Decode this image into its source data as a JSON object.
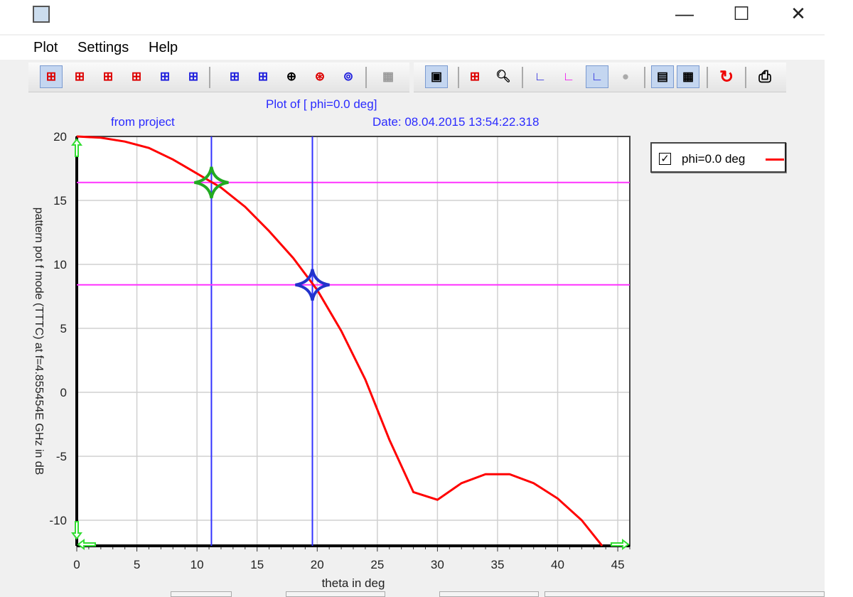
{
  "menu": [
    "Plot",
    "Settings",
    "Help"
  ],
  "window": {
    "minimize": "—",
    "maximize": "☐",
    "close": "✕"
  },
  "header": {
    "title": "Plot of [ phi=0.0 deg]",
    "source": "from project",
    "date": "Date: 08.04.2015 13:54:22.318"
  },
  "legend": {
    "label": "phi=0.0 deg",
    "checked": "✓"
  },
  "chart_data": {
    "type": "line",
    "title": "Plot of [ phi=0.0 deg]",
    "xlabel": "theta in deg",
    "ylabel": "pattern pot f mode (TTTC) at f=4.855454E GHz in dB",
    "xlim": [
      0,
      46
    ],
    "ylim": [
      -12,
      20
    ],
    "xticks": [
      0,
      5,
      10,
      15,
      20,
      25,
      30,
      35,
      40,
      45
    ],
    "yticks": [
      20,
      15,
      10,
      5,
      0,
      -5,
      -10
    ],
    "grid": true,
    "legend_position": "right",
    "series": [
      {
        "name": "phi=0.0 deg",
        "color": "#ff0000",
        "x": [
          0,
          2,
          4,
          6,
          8,
          10,
          12,
          14,
          16,
          18,
          20,
          22,
          24,
          26,
          28,
          30,
          32,
          34,
          36,
          38,
          40,
          42,
          43.7
        ],
        "y": [
          20,
          19.9,
          19.6,
          19.1,
          18.2,
          17.1,
          16,
          14.5,
          12.6,
          10.5,
          8,
          4.8,
          1,
          -3.7,
          -7.8,
          -8.4,
          -7.1,
          -6.4,
          -6.4,
          -7.1,
          -8.3,
          -10,
          -12
        ]
      }
    ],
    "cursors": [
      {
        "x": 11.2,
        "y": 16.4,
        "color": "#22aa22"
      },
      {
        "x": 19.6,
        "y": 8.4,
        "color": "#2233cc"
      }
    ]
  }
}
